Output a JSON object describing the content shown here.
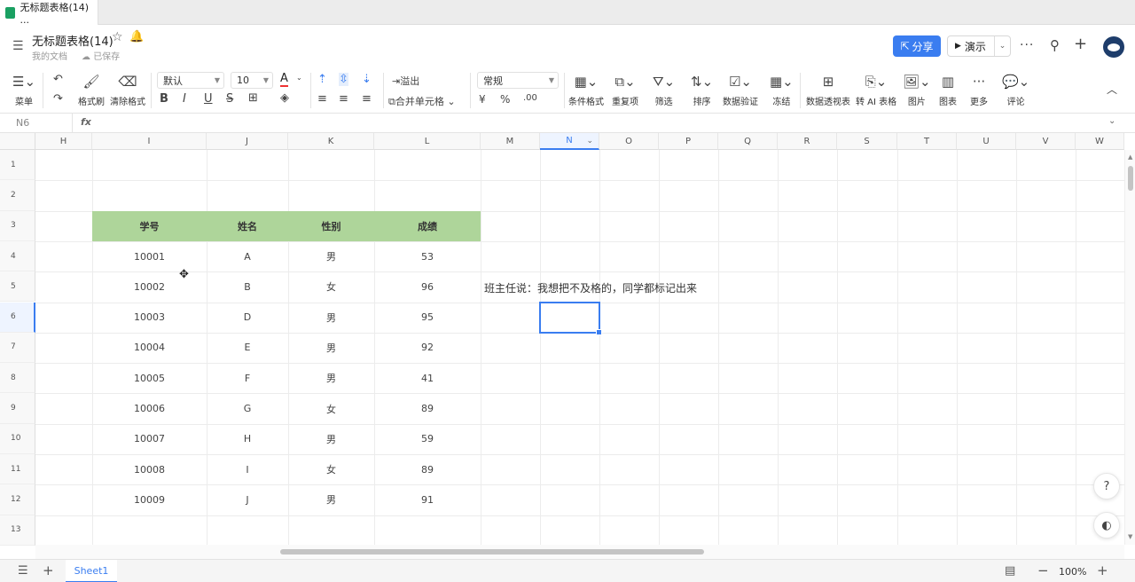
{
  "browser_tab": {
    "title": "无标题表格(14) ..."
  },
  "doc": {
    "title": "无标题表格(14)",
    "location": "我的文档",
    "save_status": "已保存"
  },
  "header": {
    "share_label": "分享",
    "present_label": "演示"
  },
  "toolbar": {
    "menu": "菜单",
    "format_painter": "格式刷",
    "clear_format": "清除格式",
    "font": "默认",
    "font_size": "10",
    "overflow": "溢出",
    "merge": "合并单元格",
    "number_format": "常规",
    "currency": "¥",
    "percent": "%",
    "conditional": "条件格式",
    "duplicates": "重复项",
    "filter": "筛选",
    "sort": "排序",
    "validation": "数据验证",
    "freeze": "冻结",
    "pivot": "数据透视表",
    "ai_table": "转 AI 表格",
    "image": "图片",
    "chart": "图表",
    "more": "更多",
    "comment": "评论"
  },
  "formula_bar": {
    "cell_ref": "N6",
    "fx": "fx"
  },
  "columns": [
    "H",
    "I",
    "J",
    "K",
    "L",
    "M",
    "N",
    "O",
    "P",
    "Q",
    "R",
    "S",
    "T",
    "U",
    "V",
    "W"
  ],
  "rows": [
    "1",
    "2",
    "3",
    "4",
    "5",
    "6",
    "7",
    "8",
    "9",
    "10",
    "11",
    "12",
    "13"
  ],
  "table": {
    "headers": [
      "学号",
      "姓名",
      "性别",
      "成绩"
    ],
    "rows": [
      [
        "10001",
        "A",
        "男",
        "53"
      ],
      [
        "10002",
        "B",
        "女",
        "96"
      ],
      [
        "10003",
        "D",
        "男",
        "95"
      ],
      [
        "10004",
        "E",
        "男",
        "92"
      ],
      [
        "10005",
        "F",
        "男",
        "41"
      ],
      [
        "10006",
        "G",
        "女",
        "89"
      ],
      [
        "10007",
        "H",
        "男",
        "59"
      ],
      [
        "10008",
        "I",
        "女",
        "89"
      ],
      [
        "10009",
        "J",
        "男",
        "91"
      ]
    ]
  },
  "note": "班主任说：我想把不及格的，同学都标记出来",
  "bottom": {
    "sheet": "Sheet1",
    "zoom": "100%"
  }
}
